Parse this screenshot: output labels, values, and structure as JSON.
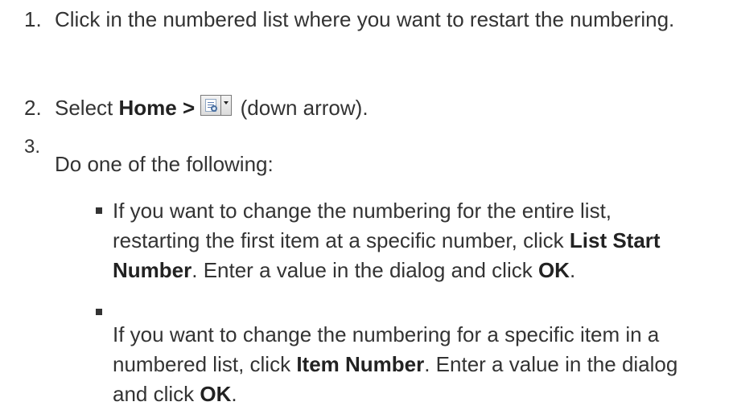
{
  "steps": [
    {
      "number": "1.",
      "text": "Click in the numbered list where you want to restart the numbering."
    },
    {
      "number": "2.",
      "prefix": "Select ",
      "menu": "Home >",
      "button_icon": "list-restart-icon",
      "suffix": " (down arrow)."
    },
    {
      "number": "3.",
      "text": "Do one of the following:"
    }
  ],
  "bullets": [
    {
      "part1": "If you want to change the numbering for the entire list, restarting the first item at a specific number, click ",
      "bold1": "List Start Number",
      "part2": ". Enter a value in the dialog and click ",
      "bold2": "OK",
      "part3": "."
    },
    {
      "part1": "If you want to change the numbering for a specific item in a numbered list, click ",
      "bold1": "Item Number",
      "part2": ". Enter a value in the dialog and click ",
      "bold2": "OK",
      "part3": "."
    }
  ],
  "colors": {
    "text": "#333333",
    "background": "#ffffff"
  }
}
